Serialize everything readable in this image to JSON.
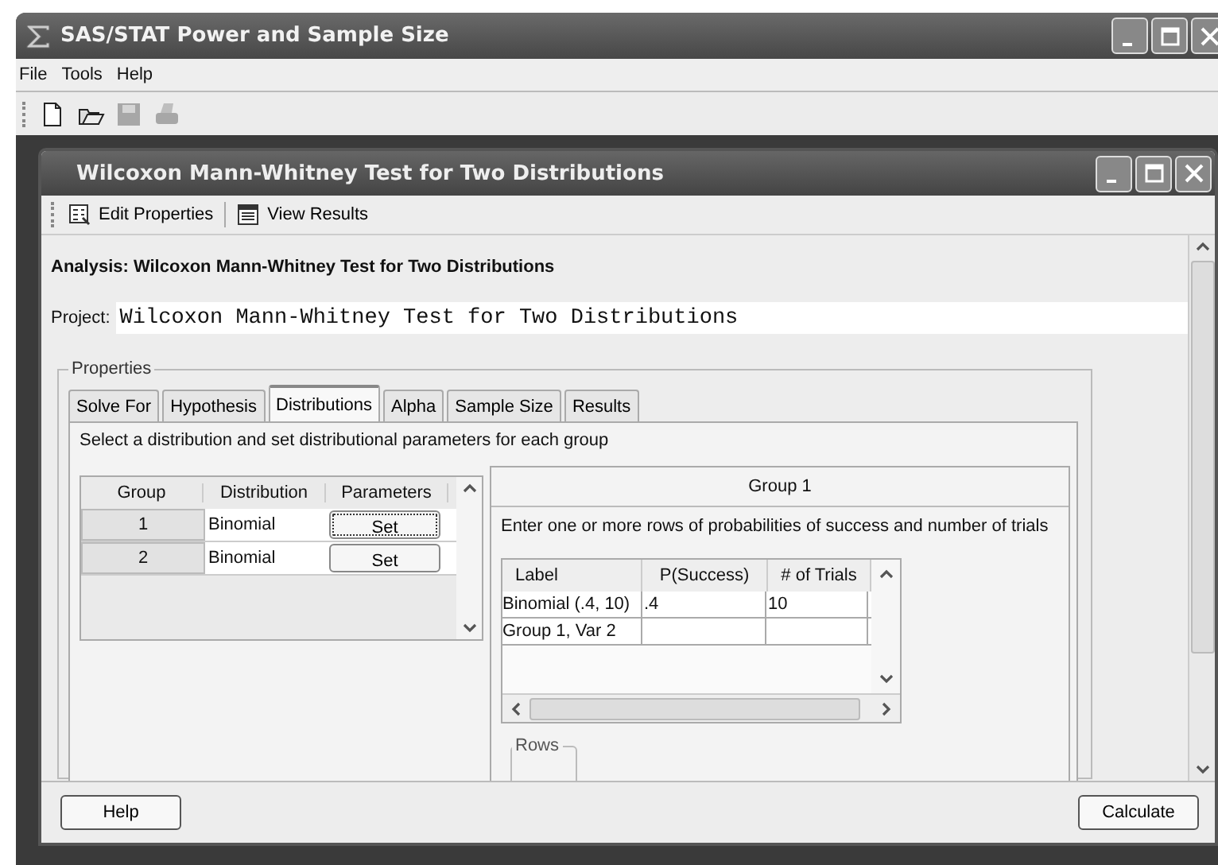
{
  "app_window": {
    "title": "SAS/STAT Power and Sample Size"
  },
  "menu": [
    "File",
    "Tools",
    "Help"
  ],
  "toolbar": [
    {
      "kind": "new",
      "disabled": false
    },
    {
      "kind": "open",
      "disabled": false
    },
    {
      "kind": "save",
      "disabled": true
    },
    {
      "kind": "print",
      "disabled": true
    }
  ],
  "document_window": {
    "title": "Wilcoxon Mann-Whitney Test for Two Distributions",
    "toolbar": [
      {
        "kind": "properties",
        "label": "Edit Properties"
      },
      {
        "kind": "results",
        "label": "View Results"
      }
    ],
    "analysis_heading": "Analysis: Wilcoxon Mann-Whitney Test for Two Distributions",
    "project": {
      "label": "Project:",
      "value": "Wilcoxon Mann-Whitney Test for Two Distributions"
    },
    "properties": {
      "legend": "Properties",
      "tabs": [
        {
          "label": "Solve For",
          "selected": false
        },
        {
          "label": "Hypothesis",
          "selected": false
        },
        {
          "label": "Distributions",
          "selected": true
        },
        {
          "label": "Alpha",
          "selected": false
        },
        {
          "label": "Sample Size",
          "selected": false
        },
        {
          "label": "Results",
          "selected": false
        }
      ],
      "instruction": "Select a distribution and set distributional parameters for each group",
      "groups_table": {
        "columns": [
          "Group",
          "Distribution",
          "Parameters"
        ],
        "rows": [
          {
            "group": "1",
            "distribution": "Binomial",
            "parameters": "Set",
            "focused": true
          },
          {
            "group": "2",
            "distribution": "Binomial",
            "parameters": "Set",
            "focused": false
          }
        ]
      },
      "group_panel": {
        "title": "Group 1",
        "instruction": "Enter one or more rows of probabilities of success and number of trials",
        "table": {
          "columns": [
            "Label",
            "P(Success)",
            "# of Trials"
          ],
          "rows": [
            [
              "Binomial (.4, 10)",
              ".4",
              "10"
            ],
            [
              "Group 1, Var 2",
              "",
              ""
            ]
          ]
        },
        "rows_legend": "Rows"
      }
    },
    "buttons": [
      {
        "kind": "left",
        "label": "Help"
      },
      {
        "kind": "right",
        "label": "Calculate"
      }
    ]
  }
}
